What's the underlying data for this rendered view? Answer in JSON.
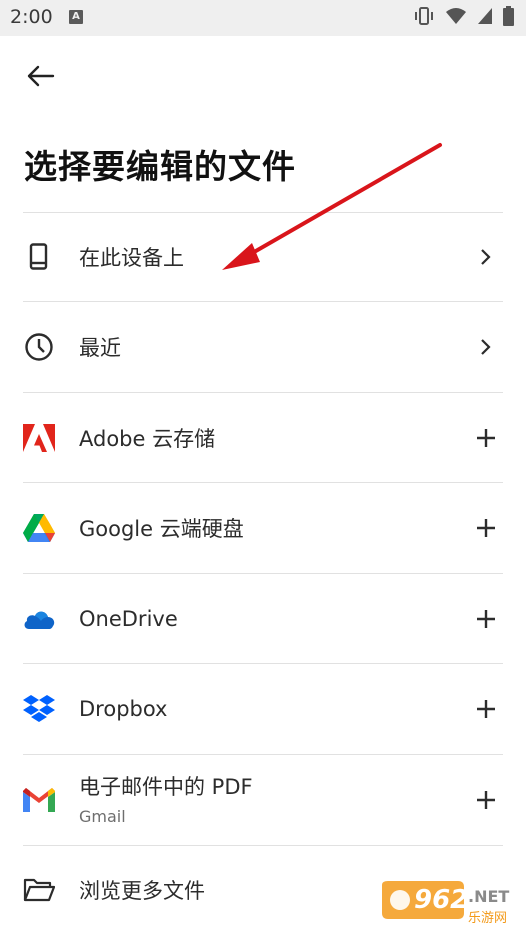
{
  "status_bar": {
    "time": "2:00",
    "notification_glyph": "A",
    "icons": [
      "vibrate-icon",
      "wifi-icon",
      "signal-icon",
      "battery-icon"
    ]
  },
  "header": {
    "title": "选择要编辑的文件"
  },
  "sources": [
    {
      "label": "在此设备上",
      "icon": "phone-icon",
      "action": "chevron"
    },
    {
      "label": "最近",
      "icon": "clock-icon",
      "action": "chevron"
    },
    {
      "label": "Adobe 云存储",
      "icon": "adobe-icon",
      "action": "plus"
    },
    {
      "label": "Google 云端硬盘",
      "icon": "google-drive-icon",
      "action": "plus"
    },
    {
      "label": "OneDrive",
      "icon": "onedrive-icon",
      "action": "plus"
    },
    {
      "label": "Dropbox",
      "icon": "dropbox-icon",
      "action": "plus"
    },
    {
      "label": "电子邮件中的 PDF",
      "sublabel": "Gmail",
      "icon": "gmail-icon",
      "action": "plus"
    },
    {
      "label": "浏览更多文件",
      "icon": "folder-icon",
      "action": "none"
    }
  ],
  "watermark": {
    "brand": "962",
    "suffix": ".NET",
    "tagline": "乐游网"
  },
  "colors": {
    "adobe_red": "#e1251b",
    "annotation_arrow": "#d9151b",
    "onedrive_blue": "#0f64c8",
    "dropbox_blue": "#0061fe",
    "status_bar_bg": "#efefef"
  }
}
